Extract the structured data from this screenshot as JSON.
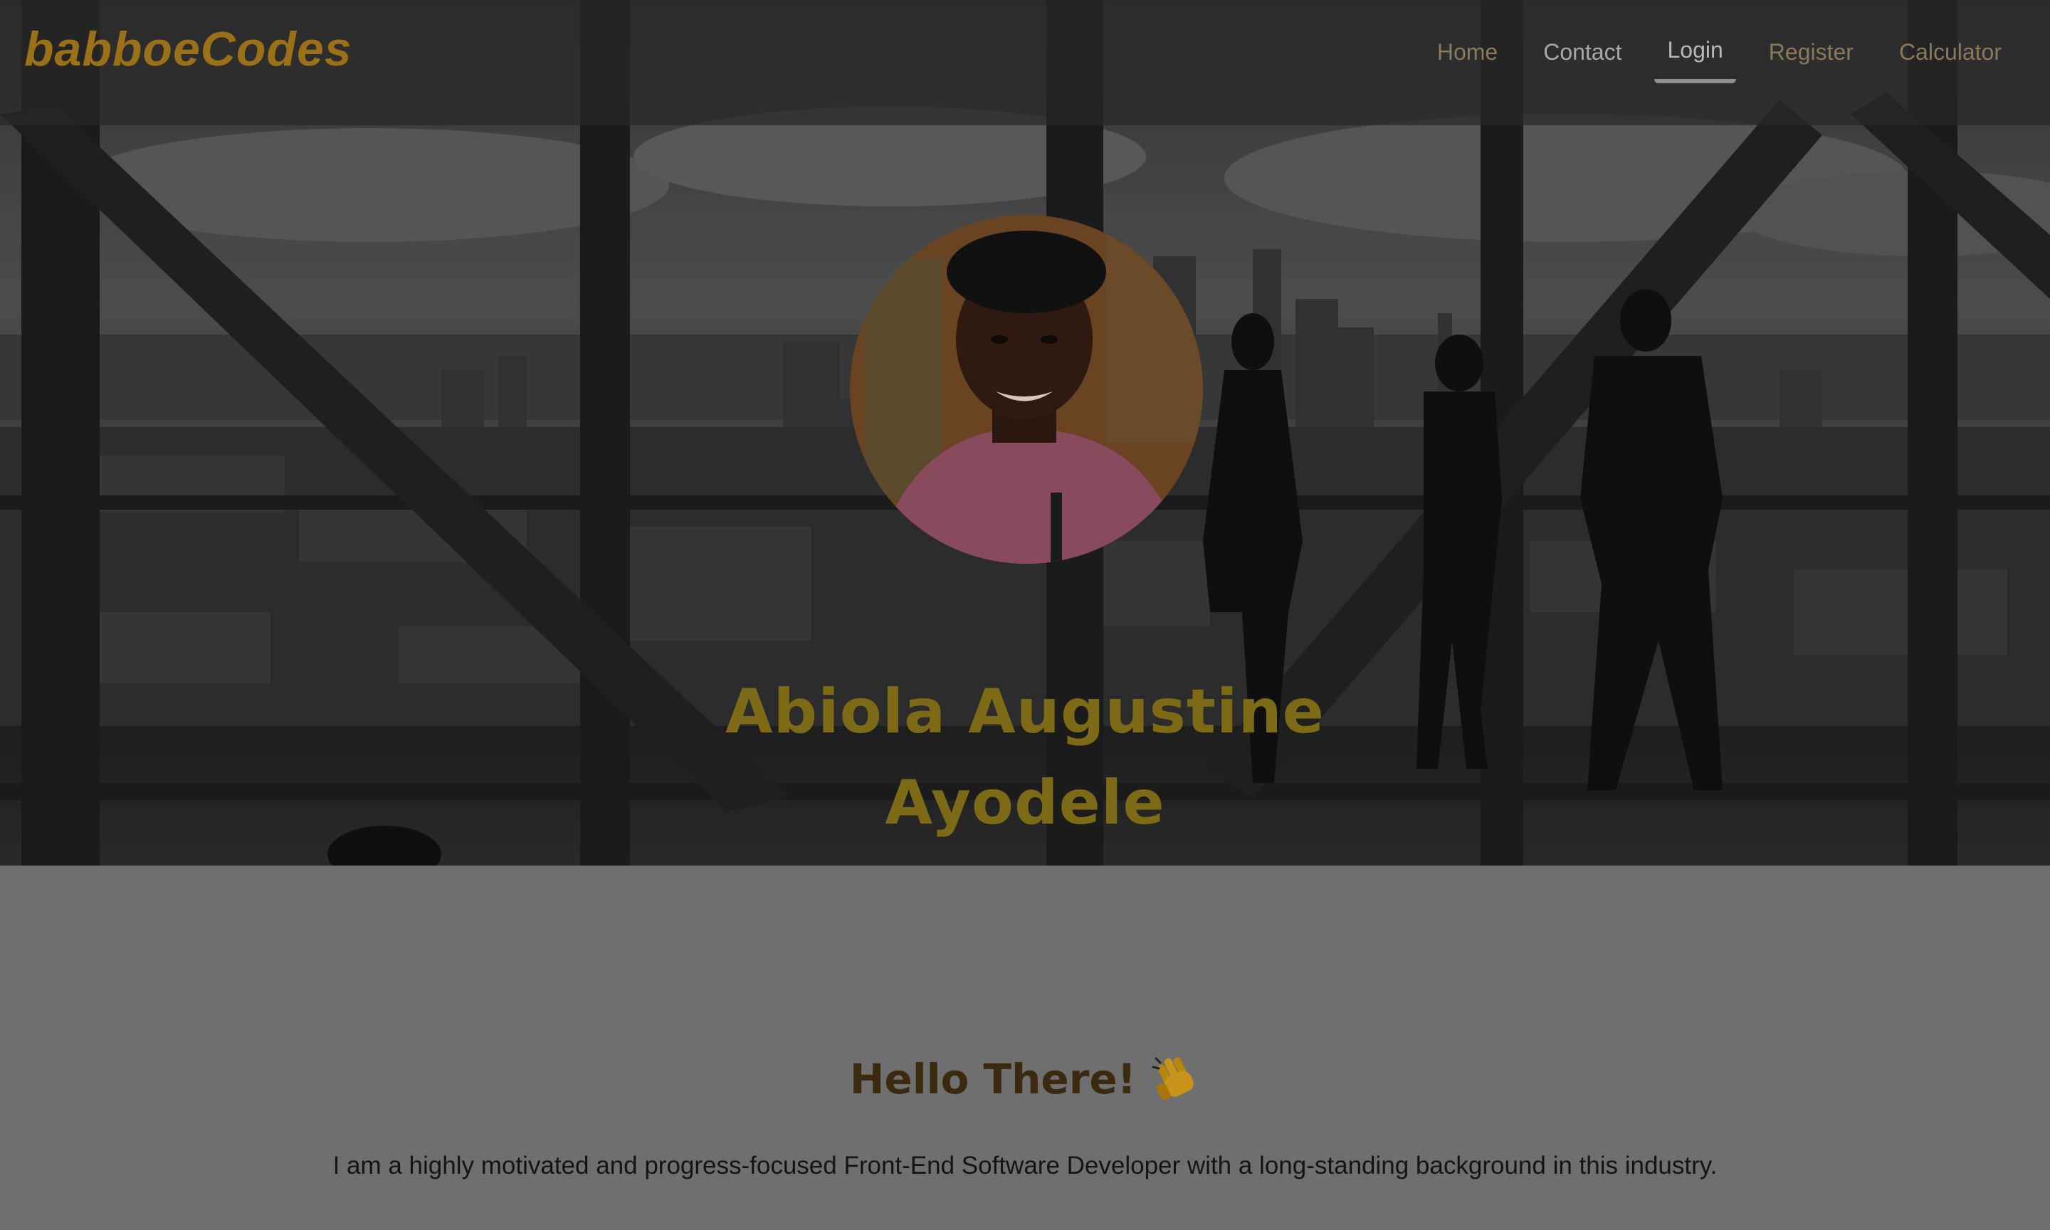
{
  "brand": {
    "name": "babboeCodes"
  },
  "nav": {
    "items": [
      {
        "label": "Home"
      },
      {
        "label": "Contact"
      },
      {
        "label": "Login"
      },
      {
        "label": "Register"
      },
      {
        "label": "Calculator"
      }
    ],
    "active": "Login"
  },
  "hero": {
    "name": "Abiola Augustine Ayodele"
  },
  "about": {
    "greeting": "Hello There!",
    "bio": "I am a highly motivated and progress-focused Front-End Software Developer with a long-standing background in this industry."
  },
  "colors": {
    "brand": "#9a7118",
    "hero_name": "#7d6a17",
    "greeting": "#3a2a10",
    "overlay": "#6f6f6f"
  },
  "icons": {
    "greeting_icon": "waving-hand-icon"
  }
}
